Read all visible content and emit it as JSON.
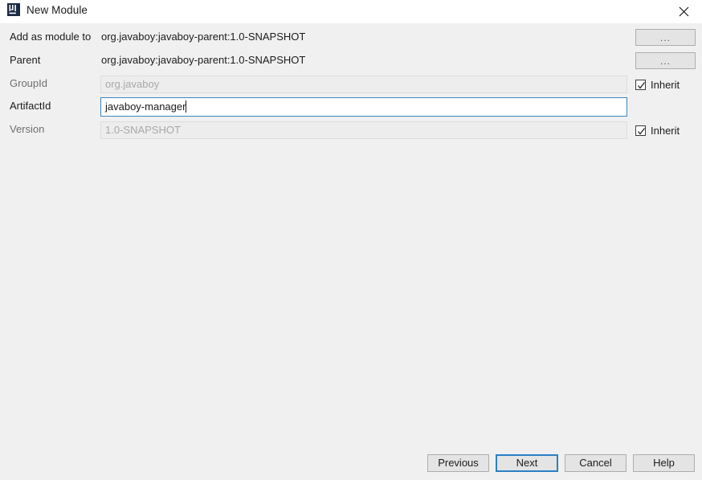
{
  "window": {
    "title": "New Module",
    "app_icon": "intellij-idea-icon",
    "close_icon": "close-icon"
  },
  "form": {
    "rows": [
      {
        "label": "Add as module to",
        "type": "static",
        "value": "org.javaboy:javaboy-parent:1.0-SNAPSHOT",
        "trailing": "ellipsis-button",
        "trailing_label": "..."
      },
      {
        "label": "Parent",
        "type": "static",
        "value": "org.javaboy:javaboy-parent:1.0-SNAPSHOT",
        "trailing": "ellipsis-button",
        "trailing_label": "..."
      },
      {
        "label": "GroupId",
        "type": "field",
        "state": "disabled",
        "value": "org.javaboy",
        "trailing": "checkbox",
        "trailing_label": "Inherit",
        "checked": true
      },
      {
        "label": "ArtifactId",
        "type": "field",
        "state": "focused",
        "value": "javaboy-manager",
        "trailing": "none",
        "trailing_label": "",
        "checked": false
      },
      {
        "label": "Version",
        "type": "field",
        "state": "disabled",
        "value": "1.0-SNAPSHOT",
        "trailing": "checkbox",
        "trailing_label": "Inherit",
        "checked": true
      }
    ]
  },
  "footer": {
    "previous_label": "Previous",
    "next_label": "Next",
    "cancel_label": "Cancel",
    "help_label": "Help"
  },
  "colors": {
    "dialog_background": "#f0f0f0",
    "titlebar_background": "#ffffff",
    "focus_blue": "#2a80c6",
    "field_border_focus": "#3b87bd",
    "disabled_text": "#a8a8a8",
    "label_text": "#1b1b1b",
    "app_icon_background": "#1c2a44"
  }
}
